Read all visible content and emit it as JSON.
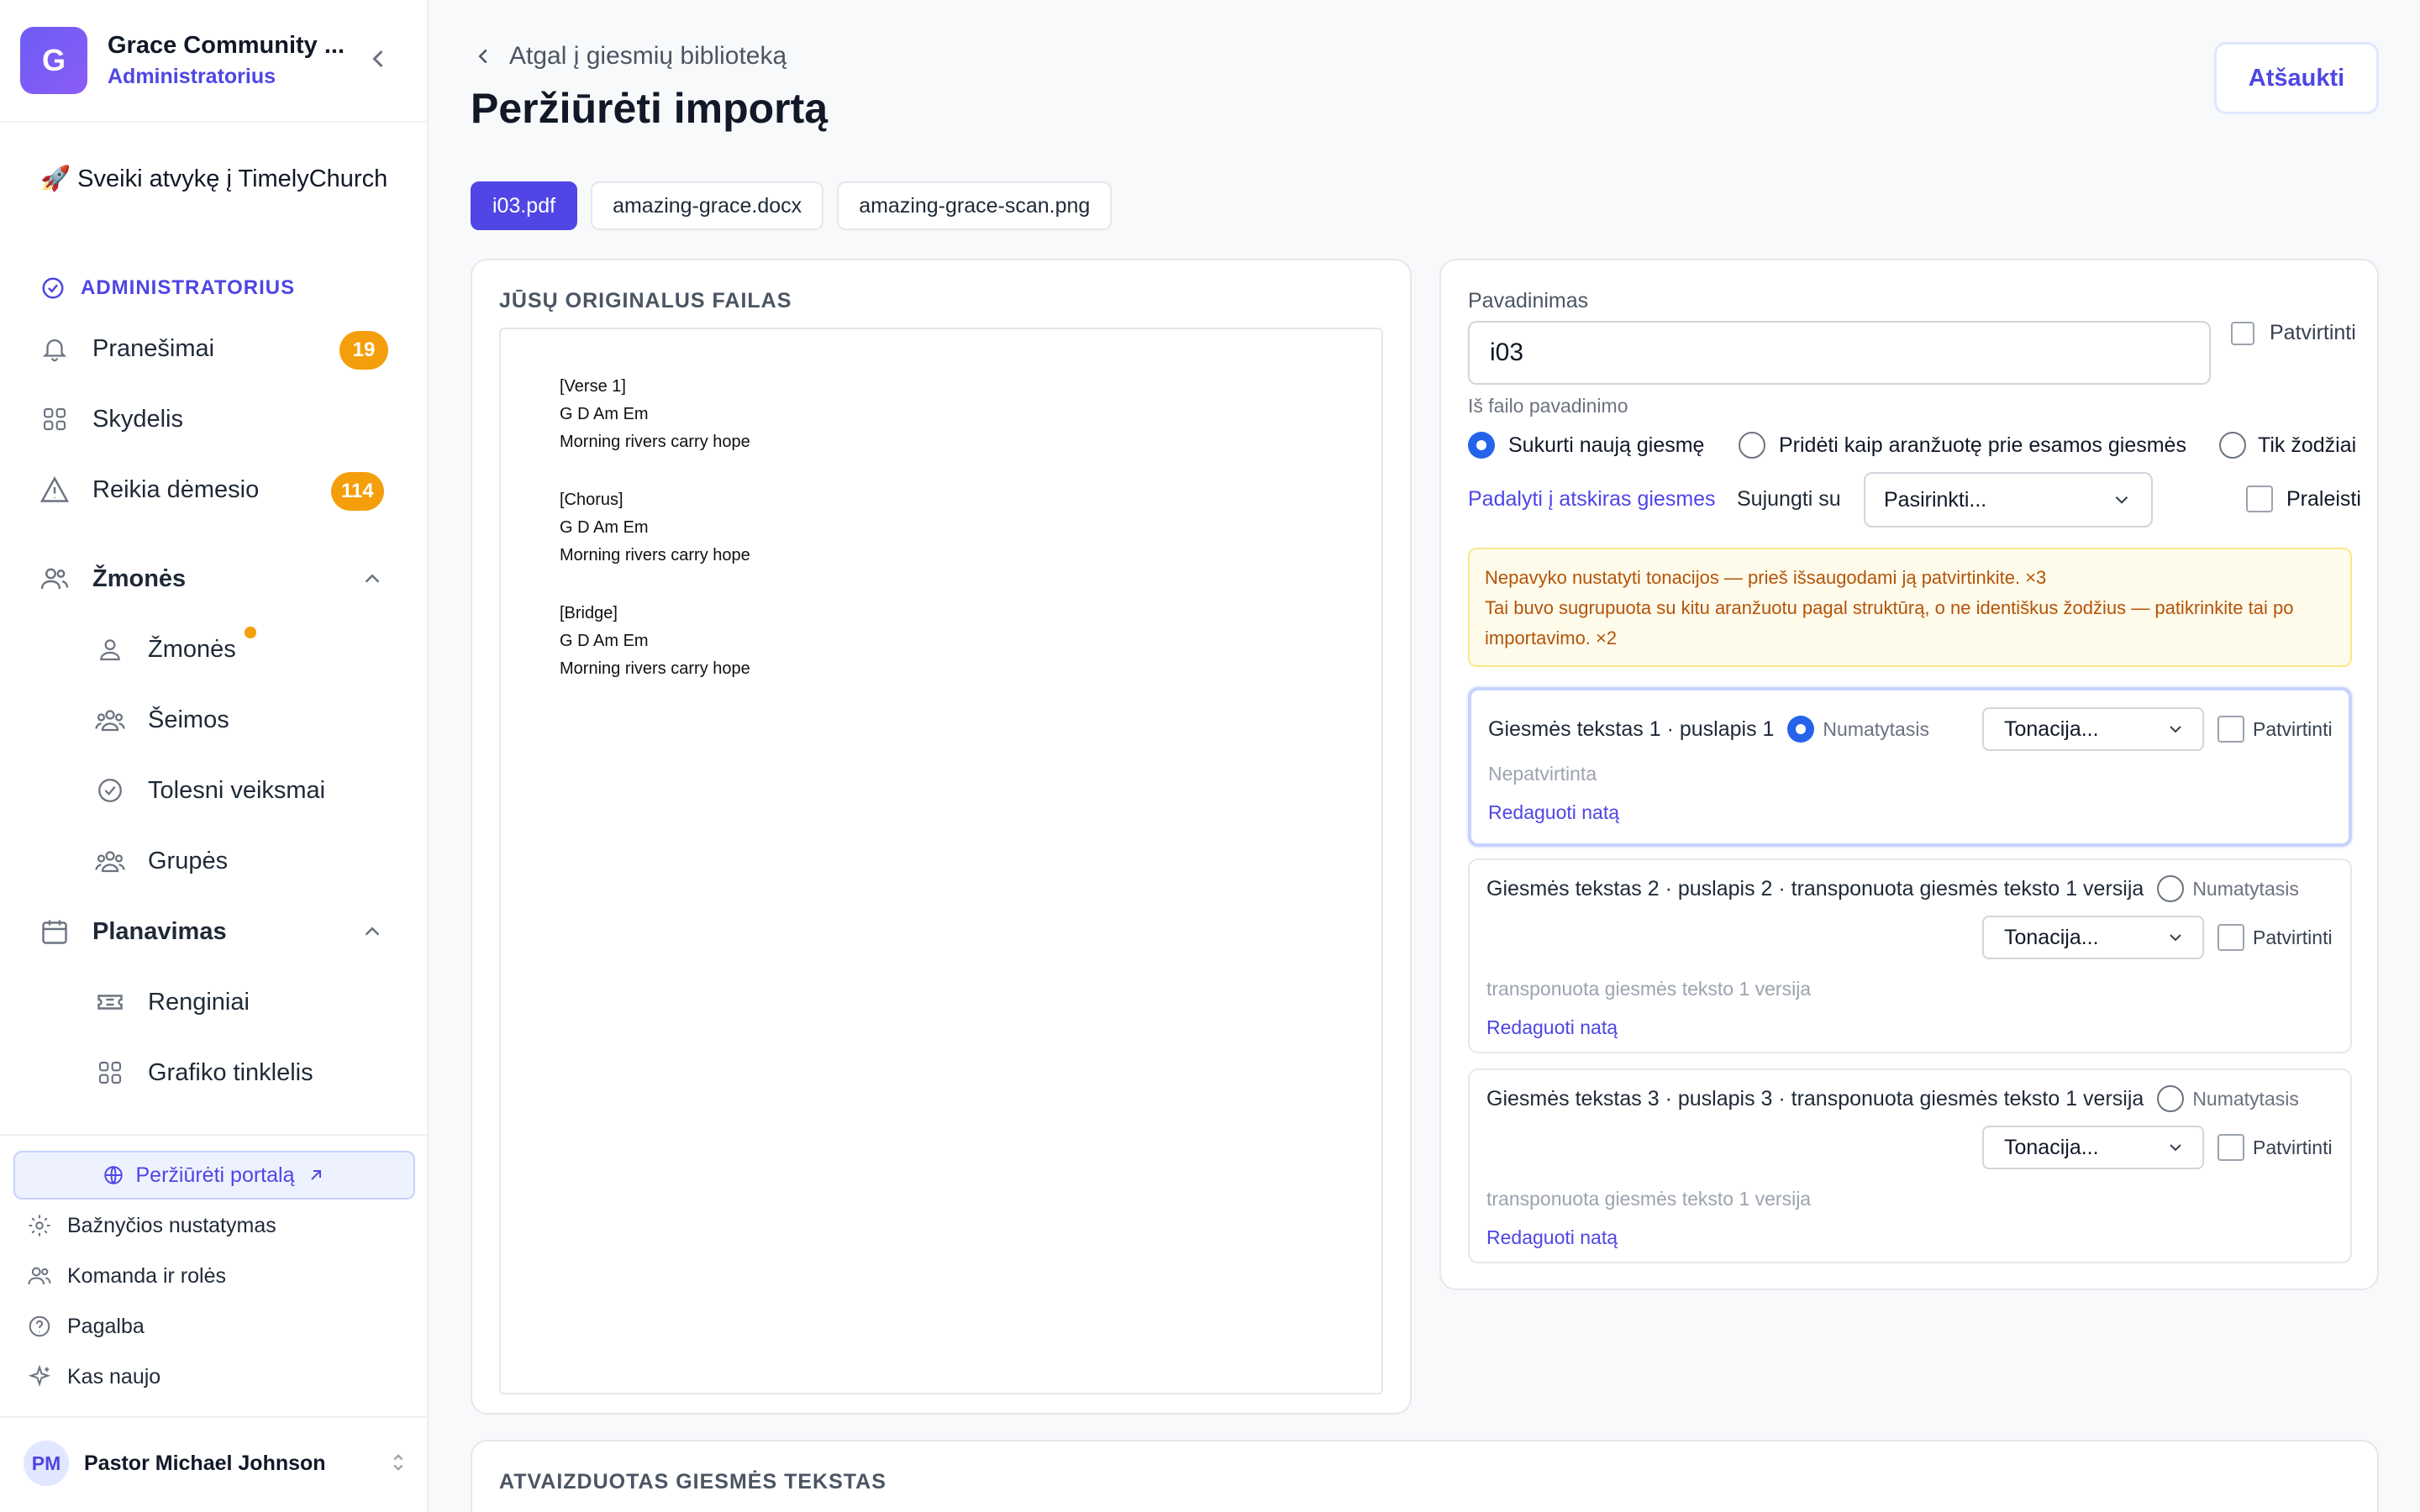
{
  "org": {
    "initial": "G",
    "name": "Grace Community ...",
    "role": "Administratorius"
  },
  "welcome": "🚀 Sveiki atvykę į TimelyChurch",
  "sidebar": {
    "section": "ADMINISTRATORIUS",
    "items": [
      {
        "label": "Pranešimai",
        "badge": "19",
        "icon": "bell-icon"
      },
      {
        "label": "Skydelis",
        "icon": "grid-icon"
      },
      {
        "label": "Reikia dėmesio",
        "badge": "114",
        "icon": "warning-icon"
      },
      {
        "label": "Žmonės",
        "icon": "people-icon"
      },
      {
        "label": "Žmonės",
        "icon": "person-icon"
      },
      {
        "label": "Šeimos",
        "icon": "family-icon"
      },
      {
        "label": "Tolesni veiksmai",
        "icon": "check-circle-icon"
      },
      {
        "label": "Grupės",
        "icon": "groups-icon"
      },
      {
        "label": "Planavimas",
        "icon": "calendar-icon"
      },
      {
        "label": "Renginiai",
        "icon": "ticket-icon"
      },
      {
        "label": "Grafiko tinklelis",
        "icon": "grid-icon"
      }
    ],
    "portal": "Peržiūrėti portalą",
    "footer": [
      "Bažnyčios nustatymas",
      "Komanda ir rolės",
      "Pagalba",
      "Kas naujo"
    ],
    "user": {
      "initials": "PM",
      "name": "Pastor Michael Johnson"
    }
  },
  "header": {
    "back": "Atgal į giesmių biblioteką",
    "title": "Peržiūrėti importą",
    "cancel": "Atšaukti"
  },
  "tabs": [
    "i03.pdf",
    "amazing-grace.docx",
    "amazing-grace-scan.png"
  ],
  "original": {
    "heading": "JŪSŲ ORIGINALUS FAILAS",
    "lines": [
      "[Verse 1]",
      "G D Am Em",
      "Morning rivers carry hope",
      "",
      "[Chorus]",
      "G D Am Em",
      "Morning rivers carry hope",
      "",
      "[Bridge]",
      "G D Am Em",
      "Morning rivers carry hope"
    ]
  },
  "form": {
    "name_label": "Pavadinimas",
    "name_value": "i03",
    "confirm": "Patvirtinti",
    "hint": "Iš failo pavadinimo",
    "options": [
      "Sukurti naują giesmę",
      "Pridėti kaip aranžuotę prie esamos giesmės",
      "Tik žodžiai"
    ],
    "split": "Padalyti į atskiras giesmes",
    "merge_label": "Sujungti su",
    "merge_value": "Pasirinkti...",
    "skip": "Praleisti",
    "warnings": [
      "Nepavyko nustatyti tonacijos — prieš išsaugodami ją patvirtinkite. ×3",
      "Tai buvo sugrupuota su kitu aranžuotu pagal struktūrą, o ne identiškus žodžius — patikrinkite tai po importavimo. ×2"
    ]
  },
  "lyrics": [
    {
      "title": "Giesmės tekstas 1 · puslapis 1",
      "default": "Numatytasis",
      "key": "Tonacija...",
      "confirm": "Patvirtinti",
      "note": "Nepatvirtinta",
      "edit": "Redaguoti natą"
    },
    {
      "title": "Giesmės tekstas 2 · puslapis 2 · transponuota giesmės teksto 1 versija",
      "default": "Numatytasis",
      "key": "Tonacija...",
      "confirm": "Patvirtinti",
      "note": "transponuota giesmės teksto 1 versija",
      "edit": "Redaguoti natą"
    },
    {
      "title": "Giesmės tekstas 3 · puslapis 3 · transponuota giesmės teksto 1 versija",
      "default": "Numatytasis",
      "key": "Tonacija...",
      "confirm": "Patvirtinti",
      "note": "transponuota giesmės teksto 1 versija",
      "edit": "Redaguoti natą"
    }
  ],
  "rendered_heading": "ATVAIZDUOTAS GIESMĖS TEKSTAS",
  "colors": {
    "accent": "#4f46e5",
    "badge": "#f59e0b",
    "warning_bg": "#fffbeb",
    "radio": "#2563eb"
  }
}
